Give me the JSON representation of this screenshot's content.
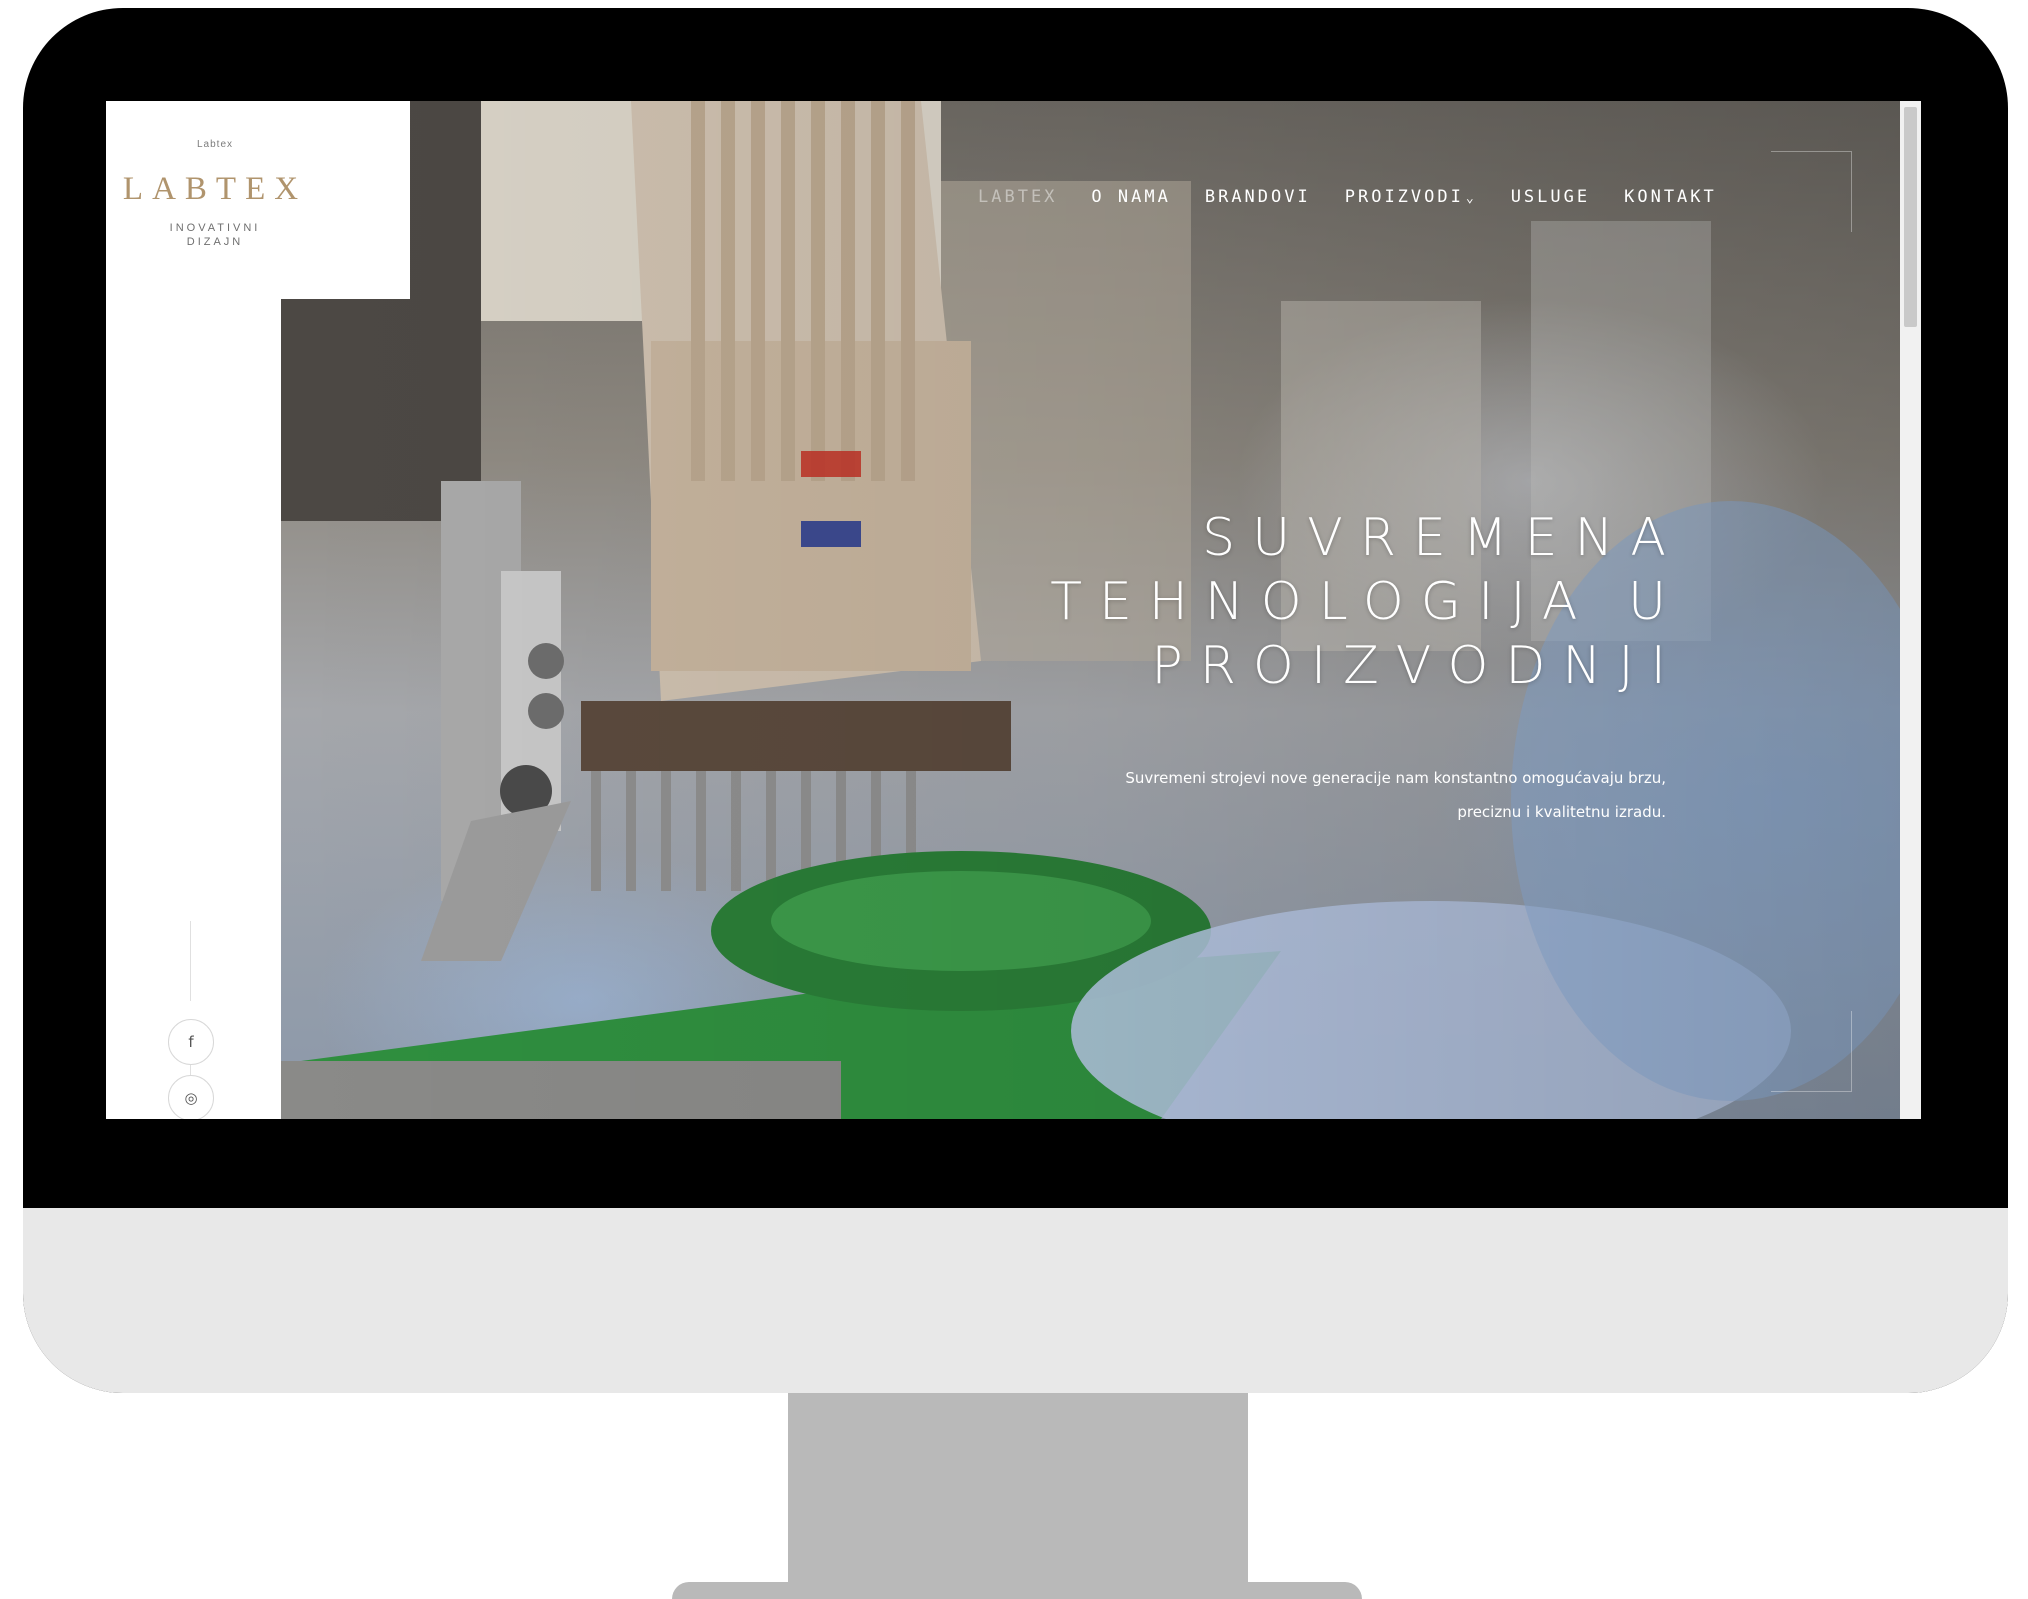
{
  "brand": {
    "small_text": "Labtex",
    "name": "LABTEX",
    "tagline_line1": "INOVATIVNI",
    "tagline_line2": "DIZAJN"
  },
  "nav": {
    "items": [
      {
        "label": "LABTEX"
      },
      {
        "label": "O NAMA"
      },
      {
        "label": "BRANDOVI"
      },
      {
        "label": "PROIZVODI"
      },
      {
        "label": "USLUGE"
      },
      {
        "label": "KONTAKT"
      }
    ],
    "dropdown_caret": "⌄"
  },
  "hero": {
    "title_line1": "SUVREMENA",
    "title_line2": "TEHNOLOGIJA U",
    "title_line3": "PROIZVODNJI",
    "text_line1": "Suvremeni strojevi nove generacije nam konstantno omogućavaju brzu,",
    "text_line2": "preciznu i kvalitetnu izradu."
  },
  "social": {
    "facebook_glyph": "f",
    "instagram_glyph": "◎"
  },
  "colors": {
    "logo_gold": "#b0946d",
    "monitor_bezel": "#000000",
    "monitor_chin": "#e8e8e8",
    "stand": "#b9b9b9"
  }
}
